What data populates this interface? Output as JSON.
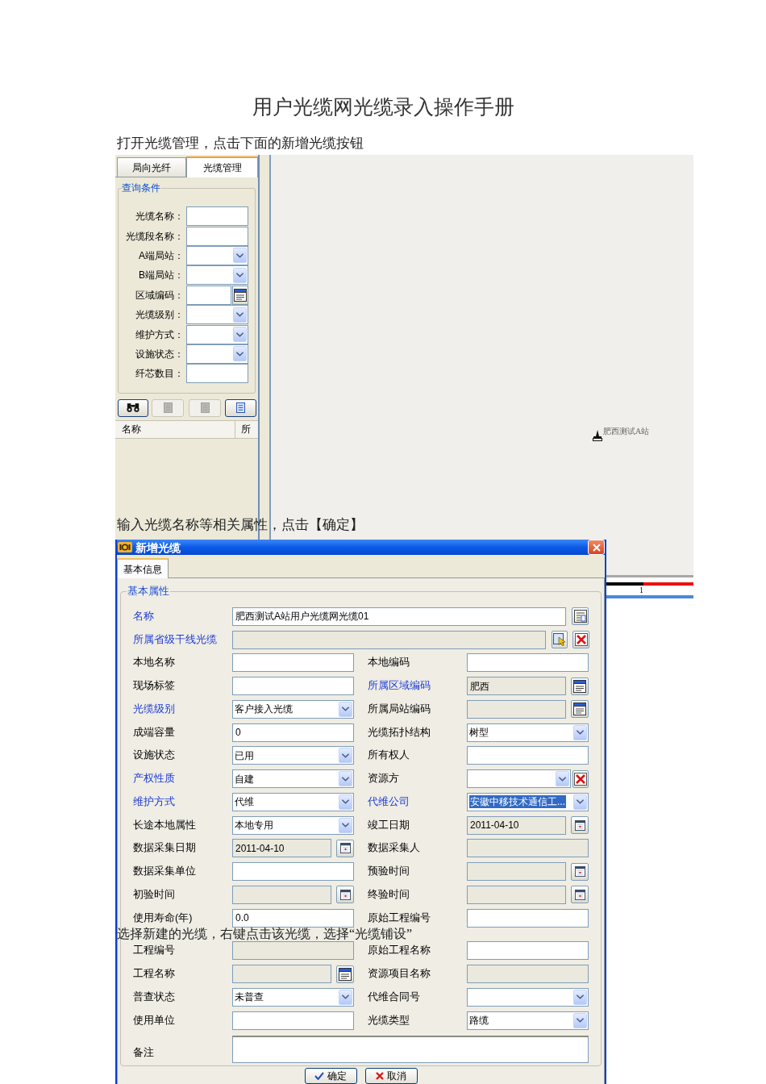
{
  "title": "用户光缆网光缆录入操作手册",
  "captions": [
    "打开光缆管理，点击下面的新增光缆按钮",
    "输入光缆名称等相关属性，点击【确定】",
    "选择新建的光缆，右键点击该光缆，选择“光缆铺设”"
  ],
  "cable_manager": {
    "tabs": [
      {
        "label": "局向光纤",
        "selected": false
      },
      {
        "label": "光缆管理",
        "selected": true
      }
    ],
    "query": {
      "legend": "查询条件",
      "fields": [
        {
          "label": "光缆名称：",
          "kind": "text"
        },
        {
          "label": "光缆段名称：",
          "kind": "text"
        },
        {
          "label": "A端局站：",
          "kind": "select"
        },
        {
          "label": "B端局站：",
          "kind": "select"
        },
        {
          "label": "区域编码：",
          "kind": "picker"
        },
        {
          "label": "光缆级别：",
          "kind": "select"
        },
        {
          "label": "维护方式：",
          "kind": "select"
        },
        {
          "label": "设施状态：",
          "kind": "select"
        },
        {
          "label": "纤芯数目：",
          "kind": "text"
        }
      ]
    },
    "toolbar": [
      {
        "disabled": false
      },
      {
        "disabled": true
      },
      {
        "disabled": true
      },
      {
        "disabled": false
      }
    ],
    "results_table": {
      "columns": [
        "名称",
        "所"
      ]
    },
    "map": {
      "stations": [
        {
          "label": "肥西测试A站"
        }
      ],
      "scale_label": "1"
    }
  },
  "new_cable_dialog": {
    "title": "新增光缆",
    "tabs": [
      {
        "label": "基本信息",
        "selected": true
      }
    ],
    "group": "基本属性",
    "rows": [
      [
        {
          "label": "名称",
          "required": true,
          "kind": "name",
          "value": "肥西测试A站用户光缆网光缆01",
          "value_selected": false
        }
      ],
      [
        {
          "label": "所属省级干线光缆",
          "required": true,
          "kind": "lookup",
          "value_selected": false
        }
      ],
      [
        {
          "label": "本地名称",
          "required": false,
          "kind": "text",
          "value_selected": false
        },
        {
          "label": "本地编码",
          "required": false,
          "kind": "text",
          "value_selected": false
        }
      ],
      [
        {
          "label": "现场标签",
          "required": false,
          "kind": "text",
          "value_selected": false
        },
        {
          "label": "所属区域编码",
          "required": true,
          "kind": "picker",
          "value": "肥西",
          "value_selected": false
        }
      ],
      [
        {
          "label": "光缆级别",
          "required": true,
          "kind": "select",
          "value": "客户接入光缆",
          "value_selected": false
        },
        {
          "label": "所属局站编码",
          "required": false,
          "kind": "picker",
          "value_selected": false
        }
      ],
      [
        {
          "label": "成端容量",
          "required": false,
          "kind": "text",
          "value": "0",
          "value_selected": false
        },
        {
          "label": "光缆拓扑结构",
          "required": false,
          "kind": "select",
          "value": "树型",
          "value_selected": false
        }
      ],
      [
        {
          "label": "设施状态",
          "required": false,
          "kind": "select",
          "value": "已用",
          "value_selected": false
        },
        {
          "label": "所有权人",
          "required": false,
          "kind": "text",
          "value_selected": false
        }
      ],
      [
        {
          "label": "产权性质",
          "required": true,
          "kind": "select",
          "value": "自建",
          "value_selected": false
        },
        {
          "label": "资源方",
          "required": false,
          "kind": "select_clear",
          "value_selected": false
        }
      ],
      [
        {
          "label": "维护方式",
          "required": true,
          "kind": "select",
          "value": "代维",
          "value_selected": false
        },
        {
          "label": "代维公司",
          "required": true,
          "kind": "select",
          "value": "安徽中移技术通信工...",
          "value_selected": true
        }
      ],
      [
        {
          "label": "长途本地属性",
          "required": false,
          "kind": "select",
          "value": "本地专用",
          "value_selected": false
        },
        {
          "label": "竣工日期",
          "required": false,
          "kind": "date",
          "value": "2011-04-10",
          "value_selected": false
        }
      ],
      [
        {
          "label": "数据采集日期",
          "required": false,
          "kind": "date",
          "value": "2011-04-10",
          "value_selected": false
        },
        {
          "label": "数据采集人",
          "required": false,
          "kind": "readonly",
          "value_selected": false
        }
      ],
      [
        {
          "label": "数据采集单位",
          "required": false,
          "kind": "text",
          "value_selected": false
        },
        {
          "label": "预验时间",
          "required": false,
          "kind": "date",
          "value_selected": false
        }
      ],
      [
        {
          "label": "初验时间",
          "required": false,
          "kind": "date",
          "value_selected": false
        },
        {
          "label": "终验时间",
          "required": false,
          "kind": "date",
          "value_selected": false
        }
      ],
      [
        {
          "label": "使用寿命(年)",
          "required": false,
          "kind": "text",
          "value": "0.0",
          "value_selected": false
        },
        {
          "label": "原始工程编号",
          "required": false,
          "kind": "text",
          "value_selected": false
        }
      ],
      [
        {
          "label": "工程编号",
          "required": false,
          "kind": "readonly",
          "value_selected": false
        },
        {
          "label": "原始工程名称",
          "required": false,
          "kind": "text",
          "value_selected": false
        }
      ],
      [
        {
          "label": "工程名称",
          "required": false,
          "kind": "picker",
          "value_selected": false
        },
        {
          "label": "资源项目名称",
          "required": false,
          "kind": "readonly",
          "value_selected": false
        }
      ],
      [
        {
          "label": "普查状态",
          "required": false,
          "kind": "select",
          "value": "未普查",
          "value_selected": false
        },
        {
          "label": "代维合同号",
          "required": false,
          "kind": "select",
          "value_selected": false
        }
      ],
      [
        {
          "label": "使用单位",
          "required": false,
          "kind": "text",
          "value_selected": false
        },
        {
          "label": "光缆类型",
          "required": false,
          "kind": "select",
          "value": "路缆",
          "value_selected": false
        }
      ],
      [
        {
          "label": "备注",
          "required": false,
          "kind": "textarea",
          "value_selected": false
        }
      ]
    ],
    "buttons": [
      {
        "label": "确定",
        "kind": "ok"
      },
      {
        "label": "取消",
        "kind": "cancel"
      }
    ]
  }
}
